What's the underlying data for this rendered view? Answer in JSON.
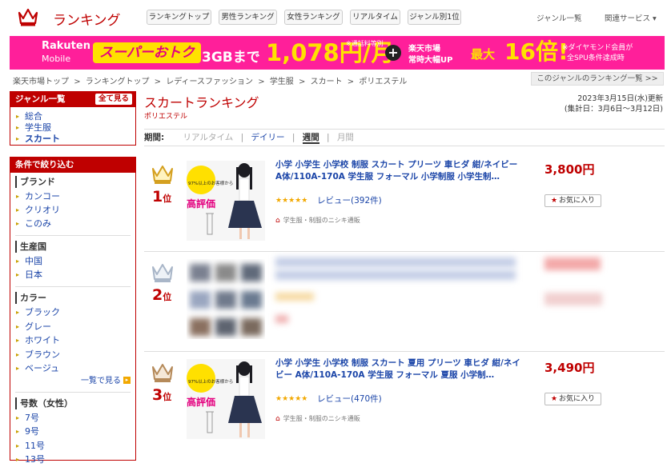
{
  "header": {
    "site_title": "ランキング",
    "nav_buttons": [
      "ランキングトップ",
      "男性ランキング",
      "女性ランキング",
      "リアルタイム",
      "ジャンル別1位"
    ],
    "links": [
      "ジャンル一覧",
      "関連サービス ▾"
    ]
  },
  "banner": {
    "brand": "Rakuten",
    "brand_sub": "Mobile",
    "campaign": "スーパーおトク",
    "plan": "3GBまで",
    "price": "1,078円/月",
    "price_note": "※通話料等別",
    "plus": "+",
    "ichiba_line1": "楽天市場",
    "ichiba_line2": "常時大幅UP",
    "max_label": "最大",
    "multiplier": "16倍!",
    "diamond_line1": "※ダイヤモンド会員が",
    "diamond_line2": "全SPU条件達成時"
  },
  "breadcrumb": [
    "楽天市場トップ",
    ">",
    "ランキングトップ",
    ">",
    "レディースファッション",
    ">",
    "学生服",
    ">",
    "スカート",
    ">",
    "ポリエステル"
  ],
  "genre_list_link": "このジャンルのランキング一覧 >>",
  "sidebar": {
    "genre_header": "ジャンル一覧",
    "show_all": "全て見る",
    "genre_items": [
      "総合",
      "学生服",
      "スカート"
    ],
    "filter_header": "条件で絞り込む",
    "sections": [
      {
        "title": "ブランド",
        "items": [
          "カンコー",
          "クリオリ",
          "このみ"
        ]
      },
      {
        "title": "生産国",
        "items": [
          "中国",
          "日本"
        ]
      },
      {
        "title": "カラー",
        "items": [
          "ブラック",
          "グレー",
          "ホワイト",
          "ブラウン",
          "ベージュ"
        ],
        "more": "一覧で見る"
      },
      {
        "title": "号数（女性）",
        "items": [
          "7号",
          "9号",
          "11号",
          "13号"
        ]
      }
    ]
  },
  "main": {
    "title": "スカートランキング",
    "subtitle": "ポリエステル",
    "updated_line1": "2023年3月15日(水)更新",
    "updated_line2": "(集計日：3月6日〜3月12日)",
    "period_label": "期間:",
    "periods": {
      "realtime": "リアルタイム",
      "daily": "デイリー",
      "weekly": "週間",
      "monthly": "月間"
    },
    "separator": "|",
    "rank_suffix": "位",
    "fav_label": "お気に入り",
    "thumb_badge": "97%以上のお客様から",
    "thumb_eval": "高評価",
    "items": [
      {
        "rank": "1",
        "title": "小学 小学生 小学校 制服 スカート プリーツ 車ヒダ 紺/ネイビー A体/110A-170A 学生服 フォーマル 小学制服 小学生制…",
        "stars": "★★★★★",
        "review": "レビュー(392件)",
        "shop": "学生服・制服のニシキ通販",
        "price": "3,800円"
      },
      {
        "rank": "2"
      },
      {
        "rank": "3",
        "title": "小学 小学生 小学校 制服 スカート 夏用 プリーツ 車ヒダ 紺/ネイビー A体/110A-170A 学生服 フォーマル 夏服 小学制…",
        "stars": "★★★★★",
        "review": "レビュー(470件)",
        "shop": "学生服・制服のニシキ通販",
        "price": "3,490円"
      }
    ]
  },
  "colors": {
    "brand_red": "#bf0000",
    "banner_pink": "#ff1f9a",
    "gold": "#d4a020",
    "silver": "#a9b6c8",
    "bronze": "#b58a5a"
  }
}
